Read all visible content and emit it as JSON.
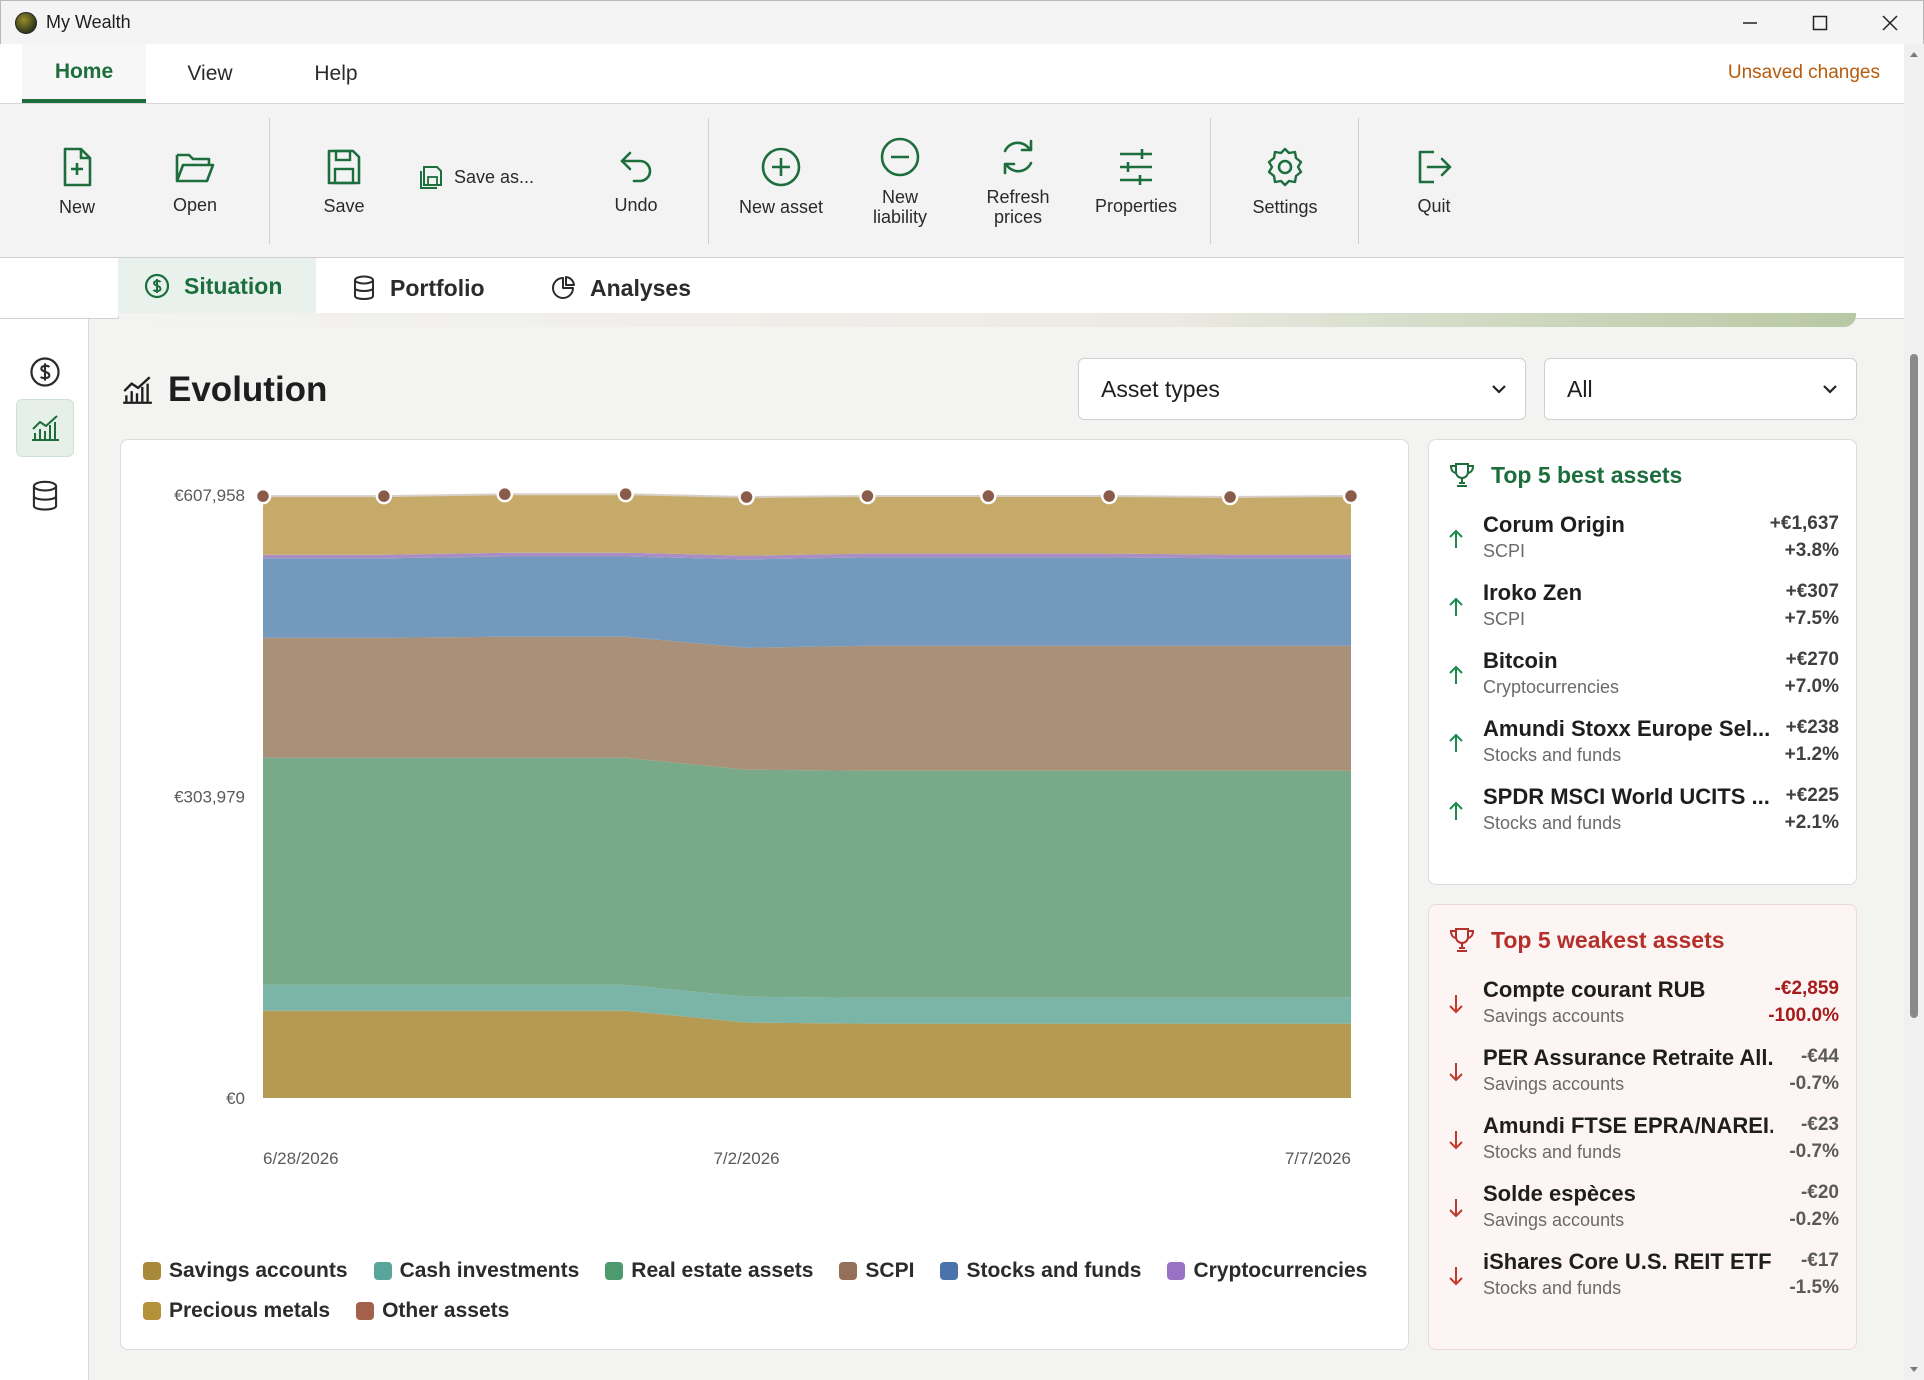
{
  "window": {
    "title": "My Wealth",
    "icons": [
      "app-logo",
      "minimize-icon",
      "maximize-icon",
      "close-icon"
    ]
  },
  "ribbon": {
    "tabs": [
      {
        "label": "Home",
        "active": true
      },
      {
        "label": "View"
      },
      {
        "label": "Help"
      }
    ],
    "status": "Unsaved changes",
    "status_color": "#b85a0c"
  },
  "toolbar": {
    "new": "New",
    "open": "Open",
    "save": "Save",
    "save_as": "Save as...",
    "undo": "Undo",
    "new_asset": "New asset",
    "new_liability": "New\nliability",
    "refresh_prices": "Refresh\nprices",
    "properties": "Properties",
    "settings": "Settings",
    "quit": "Quit",
    "accent": "#1c6e3c"
  },
  "main_tabs": [
    {
      "label": "Situation",
      "icon": "dollar-circle-icon",
      "active": true
    },
    {
      "label": "Portfolio",
      "icon": "database-icon"
    },
    {
      "label": "Analyses",
      "icon": "pie-chart-icon"
    }
  ],
  "left_rail": [
    {
      "icon": "dollar-circle-icon"
    },
    {
      "icon": "line-chart-icon",
      "active": true
    },
    {
      "icon": "database-icon"
    }
  ],
  "evolution": {
    "title": "Evolution",
    "filter_type": "Asset types",
    "filter_scope": "All"
  },
  "chart_data": {
    "type": "area",
    "stacked": true,
    "x": [
      "6/28/2026",
      "6/29/2026",
      "6/30/2026",
      "7/1/2026",
      "7/2/2026",
      "7/3/2026",
      "7/4/2026",
      "7/5/2026",
      "7/6/2026",
      "7/7/2026"
    ],
    "x_tick_labels": [
      "6/28/2026",
      "7/2/2026",
      "7/7/2026"
    ],
    "y_tick_labels": [
      "€0",
      "€303,979",
      "€607,958"
    ],
    "ylim": [
      0,
      607958
    ],
    "series": [
      {
        "name": "Savings accounts",
        "color": "#b49a52",
        "values": [
          88000,
          88000,
          88000,
          88000,
          76000,
          75000,
          75000,
          75000,
          75000,
          75000
        ]
      },
      {
        "name": "Cash investments",
        "color": "#7ab5a8",
        "values": [
          26000,
          26000,
          26000,
          26000,
          26000,
          26000,
          26000,
          26000,
          26000,
          26000
        ]
      },
      {
        "name": "Real estate assets",
        "color": "#78a988",
        "values": [
          229000,
          229000,
          229000,
          229000,
          229000,
          229000,
          229000,
          229000,
          229000,
          229000
        ]
      },
      {
        "name": "SCPI",
        "color": "#a99079",
        "values": [
          121000,
          121000,
          122000,
          122000,
          123000,
          126000,
          126000,
          126000,
          126000,
          126000
        ]
      },
      {
        "name": "Stocks and funds",
        "color": "#7399bd",
        "values": [
          80000,
          80000,
          81000,
          81000,
          89000,
          89000,
          89000,
          89000,
          88000,
          88000
        ]
      },
      {
        "name": "Cryptocurrencies",
        "color": "#a98ec6",
        "values": [
          3800,
          3800,
          3800,
          3800,
          3900,
          3900,
          3900,
          3900,
          3900,
          3900
        ]
      },
      {
        "name": "Precious metals",
        "color": "#c6aa6a",
        "values": [
          59000,
          59000,
          59000,
          59000,
          59000,
          58000,
          58000,
          58000,
          58000,
          59000
        ]
      },
      {
        "name": "Other assets",
        "color": "#a9735e",
        "values": [
          0,
          0,
          0,
          0,
          0,
          0,
          0,
          0,
          0,
          0
        ]
      }
    ],
    "legend": [
      {
        "label": "Savings accounts",
        "color": "#a8893a"
      },
      {
        "label": "Cash investments",
        "color": "#5aa59a"
      },
      {
        "label": "Real estate assets",
        "color": "#4d9a6e"
      },
      {
        "label": "SCPI",
        "color": "#94705a"
      },
      {
        "label": "Stocks and funds",
        "color": "#4a73ab"
      },
      {
        "label": "Cryptocurrencies",
        "color": "#9a72c4"
      },
      {
        "label": "Precious metals",
        "color": "#b4913a"
      },
      {
        "label": "Other assets",
        "color": "#a3604a"
      }
    ],
    "marker_color": "#8a5a4a"
  },
  "best": {
    "title": "Top 5 best assets",
    "items": [
      {
        "name": "Corum Origin",
        "category": "SCPI",
        "amount": "+€1,637",
        "pct": "+3.8%"
      },
      {
        "name": "Iroko Zen",
        "category": "SCPI",
        "amount": "+€307",
        "pct": "+7.5%"
      },
      {
        "name": "Bitcoin",
        "category": "Cryptocurrencies",
        "amount": "+€270",
        "pct": "+7.0%"
      },
      {
        "name": "Amundi Stoxx Europe Sel...",
        "category": "Stocks and funds",
        "amount": "+€238",
        "pct": "+1.2%"
      },
      {
        "name": "SPDR MSCI World UCITS ...",
        "category": "Stocks and funds",
        "amount": "+€225",
        "pct": "+2.1%"
      }
    ]
  },
  "weak": {
    "title": "Top 5 weakest assets",
    "items": [
      {
        "name": "Compte courant RUB",
        "category": "Savings accounts",
        "amount": "-€2,859",
        "pct": "-100.0%"
      },
      {
        "name": "PER Assurance Retraite All...",
        "category": "Savings accounts",
        "amount": "-€44",
        "pct": "-0.7%"
      },
      {
        "name": "Amundi FTSE EPRA/NAREI...",
        "category": "Stocks and funds",
        "amount": "-€23",
        "pct": "-0.7%"
      },
      {
        "name": "Solde espèces",
        "category": "Savings accounts",
        "amount": "-€20",
        "pct": "-0.2%"
      },
      {
        "name": "iShares Core U.S. REIT ETF",
        "category": "Stocks and funds",
        "amount": "-€17",
        "pct": "-1.5%"
      }
    ]
  }
}
